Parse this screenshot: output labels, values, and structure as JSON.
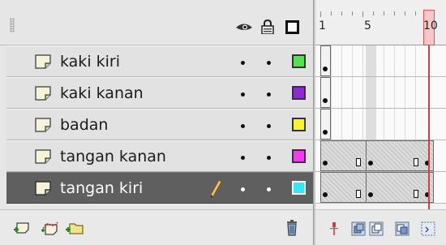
{
  "layers": [
    {
      "name": "kaki kiri",
      "color": "#55e055",
      "selected": false
    },
    {
      "name": "kaki kanan",
      "color": "#8f2ad0",
      "selected": false
    },
    {
      "name": "badan",
      "color": "#f5f530",
      "selected": false
    },
    {
      "name": "tangan kanan",
      "color": "#f23cf2",
      "selected": false
    },
    {
      "name": "tangan kiri",
      "color": "#38e8f0",
      "selected": true
    }
  ],
  "timeline": {
    "frame_labels": [
      "1",
      "5",
      "10"
    ],
    "current_frame": "10"
  },
  "colors": {
    "selected_row": "#5f5f5f",
    "playhead": "#d14040"
  },
  "icons": {
    "header": [
      "eye-icon",
      "lock-icon",
      "outline-icon"
    ],
    "bottom": [
      "new-layer-icon",
      "motion-guide-icon",
      "new-folder-icon",
      "trash-icon"
    ],
    "timeline_bottom": [
      "center-frame-icon",
      "onion-skin-icon",
      "onion-outline-icon",
      "edit-multiple-icon",
      "onion-markers-icon"
    ]
  }
}
